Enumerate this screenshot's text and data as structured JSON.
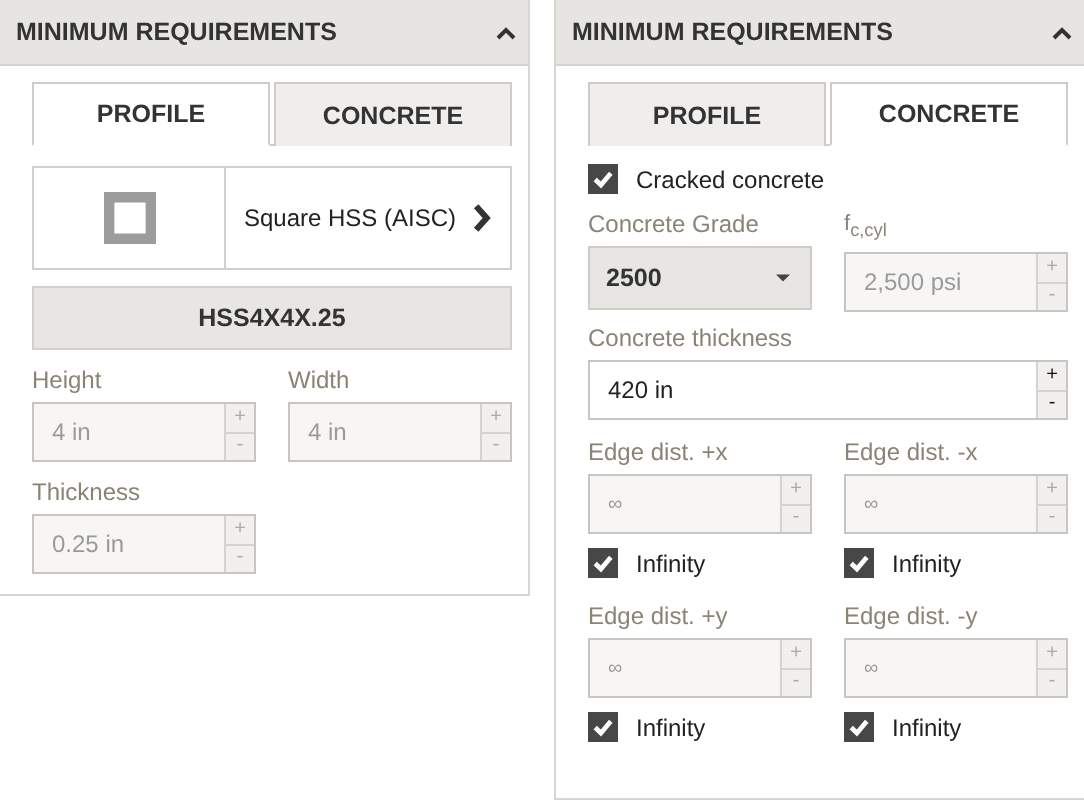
{
  "panels": [
    {
      "header": "MINIMUM REQUIREMENTS",
      "expanded": true,
      "kind": "profile",
      "tabs": [
        {
          "label": "PROFILE",
          "selected": true
        },
        {
          "label": "CONCRETE",
          "selected": false
        }
      ],
      "profile_type": {
        "label": "Square HSS (AISC)"
      },
      "section": "HSS4X4X.25",
      "fields": [
        {
          "label": "Height",
          "value": "4 in",
          "disabled": true,
          "up": "+",
          "down": "-"
        },
        {
          "label": "Width",
          "value": "4 in",
          "disabled": true,
          "up": "+",
          "down": "-"
        },
        {
          "label": "Thickness",
          "value": "0.25 in",
          "disabled": true,
          "up": "+",
          "down": "-"
        }
      ]
    },
    {
      "header": "MINIMUM REQUIREMENTS",
      "expanded": true,
      "kind": "concrete",
      "tabs": [
        {
          "label": "PROFILE",
          "selected": false
        },
        {
          "label": "CONCRETE",
          "selected": true
        }
      ],
      "cracked": {
        "label": "Cracked concrete",
        "checked": true
      },
      "grade": {
        "label": "Concrete Grade",
        "value": "2500"
      },
      "strength": {
        "label": "f$_{c,cyl}$",
        "value": "2,500 psi",
        "disabled": true,
        "up": "+",
        "down": "-"
      },
      "thickness": {
        "label": "Concrete thickness",
        "value": "420 in",
        "disabled": false,
        "up": "+",
        "down": "-"
      },
      "edges": [
        {
          "label": "Edge dist. +x",
          "value": "∞",
          "disabled": true,
          "up": "+",
          "down": "-",
          "infinity": {
            "label": "Infinity",
            "checked": true
          }
        },
        {
          "label": "Edge dist. -x",
          "value": "∞",
          "disabled": true,
          "up": "+",
          "down": "-",
          "infinity": {
            "label": "Infinity",
            "checked": true
          }
        },
        {
          "label": "Edge dist. +y",
          "value": "∞",
          "disabled": true,
          "up": "+",
          "down": "-",
          "infinity": {
            "label": "Infinity",
            "checked": true
          }
        },
        {
          "label": "Edge dist. -y",
          "value": "∞",
          "disabled": true,
          "up": "+",
          "down": "-",
          "infinity": {
            "label": "Infinity",
            "checked": true
          }
        }
      ]
    }
  ]
}
